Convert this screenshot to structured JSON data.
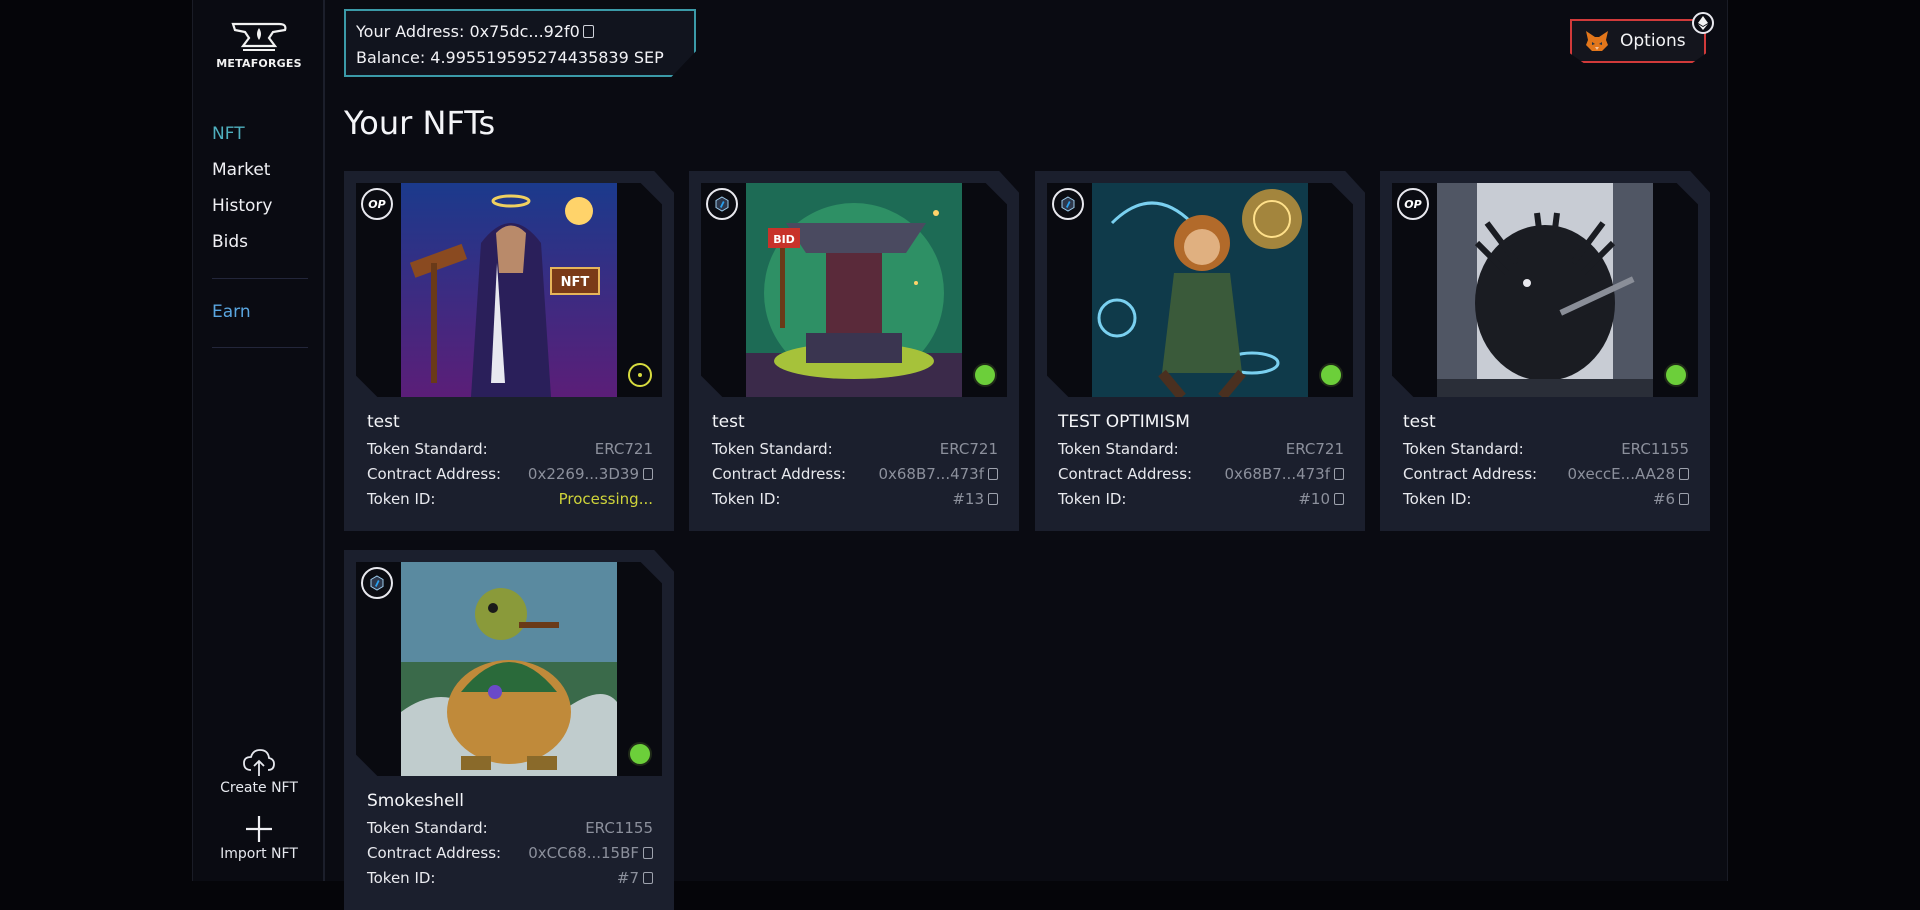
{
  "sidebar": {
    "logo_text": "METAFORGES",
    "nav": [
      {
        "label": "NFT",
        "active": true
      },
      {
        "label": "Market"
      },
      {
        "label": "History"
      },
      {
        "label": "Bids"
      }
    ],
    "earn_label": "Earn",
    "create_label": "Create NFT",
    "import_label": "Import NFT"
  },
  "wallet": {
    "address_line": "Your Address: 0x75dc...92f0",
    "balance_line": "Balance: 4.995519595274435839 SEP"
  },
  "header": {
    "options_label": "Options",
    "eth_icon": "ethereum-icon"
  },
  "page_title": "Your NFTs",
  "labels": {
    "standard": "Token Standard:",
    "contract": "Contract Address:",
    "token_id": "Token ID:"
  },
  "colors": {
    "accent_teal": "#3b9aa8",
    "options_border": "#d13a3a",
    "status_ok": "#6ccf3a",
    "status_processing": "#d7db3f"
  },
  "cards": [
    {
      "title": "test",
      "standard": "ERC721",
      "contract": "0x2269...3D39",
      "token_id": "Processing...",
      "chain": "OP",
      "status": "processing"
    },
    {
      "title": "test",
      "standard": "ERC721",
      "contract": "0x68B7...473f",
      "token_id": "#13",
      "chain": "arbitrum",
      "status": "ok"
    },
    {
      "title": "TEST OPTIMISM",
      "standard": "ERC721",
      "contract": "0x68B7...473f",
      "token_id": "#10",
      "chain": "arbitrum",
      "status": "ok"
    },
    {
      "title": "test",
      "standard": "ERC1155",
      "contract": "0xeccE...AA28",
      "token_id": "#6",
      "chain": "OP",
      "status": "ok"
    },
    {
      "title": "Smokeshell",
      "standard": "ERC1155",
      "contract": "0xCC68...15BF",
      "token_id": "#7",
      "chain": "arbitrum",
      "status": "ok"
    }
  ]
}
